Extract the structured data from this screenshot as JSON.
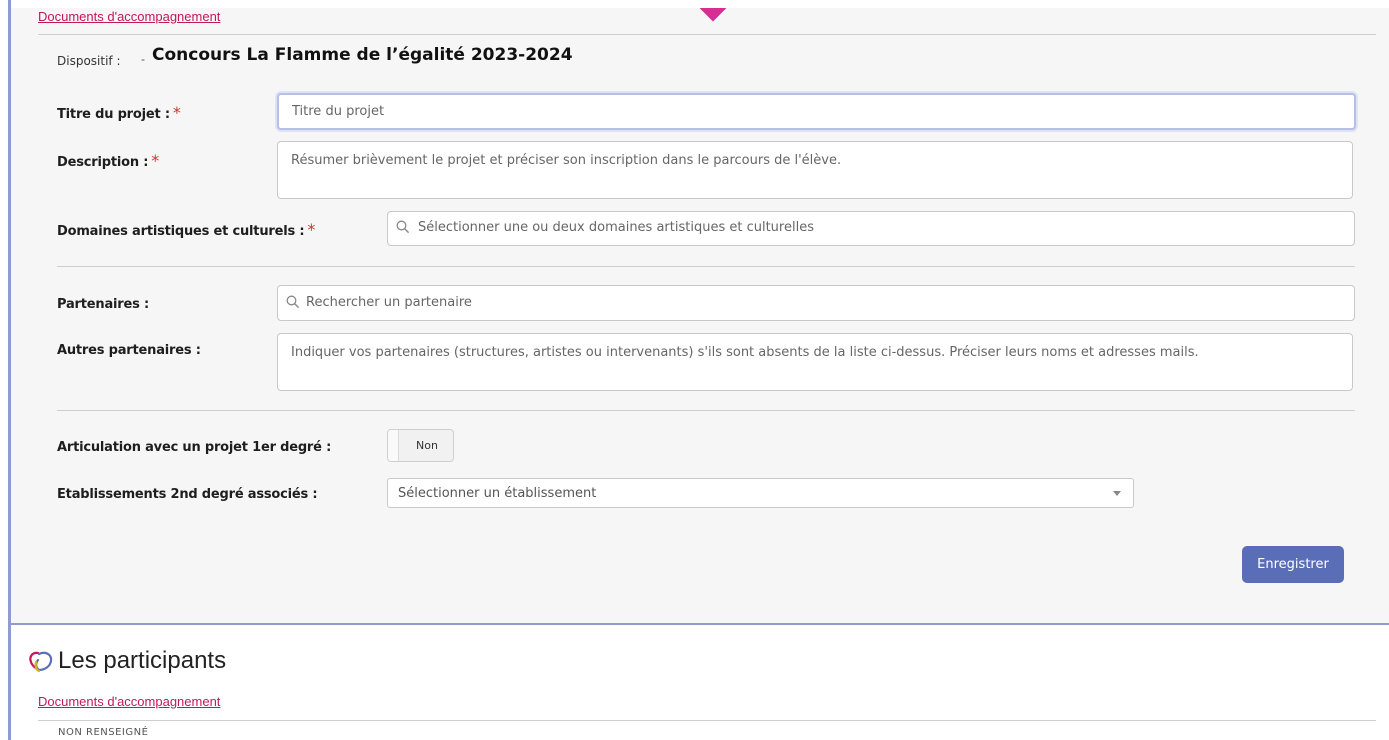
{
  "form": {
    "top_link": "Documents d'accompagnement",
    "dispositif": {
      "label": "Dispositif :",
      "dash": "-",
      "value": "Concours La Flamme de l’égalité 2023-2024"
    },
    "titre": {
      "label": "Titre du projet :",
      "required": "*",
      "placeholder": "Titre du projet"
    },
    "description": {
      "label": "Description :",
      "required": "*",
      "placeholder": "Résumer brièvement le projet et préciser son inscription dans le parcours de l'élève."
    },
    "domaines": {
      "label": "Domaines artistiques et culturels :",
      "required": "*",
      "placeholder": "Sélectionner une ou deux domaines artistiques et culturelles"
    },
    "partenaires": {
      "label": "Partenaires :",
      "placeholder": "Rechercher un partenaire"
    },
    "autres_partenaires": {
      "label": "Autres partenaires :",
      "placeholder": "Indiquer vos partenaires (structures, artistes ou intervenants) s'ils sont absents de la liste ci-dessus. Préciser leurs noms et adresses mails."
    },
    "articulation": {
      "label": "Articulation avec un projet 1er degré :",
      "toggle_value": "Non"
    },
    "etablissements": {
      "label": "Etablissements 2nd degré associés :",
      "selected": "Sélectionner un établissement"
    },
    "save_button": "Enregistrer"
  },
  "participants": {
    "title": "Les participants",
    "link": "Documents d'accompagnement",
    "status": "NON RENSEIGNÉ"
  },
  "colors": {
    "accent_blue": "#5a6eb8",
    "link_pink": "#c2185b",
    "pointer_magenta": "#d62e93",
    "required_red": "#c0392b"
  }
}
